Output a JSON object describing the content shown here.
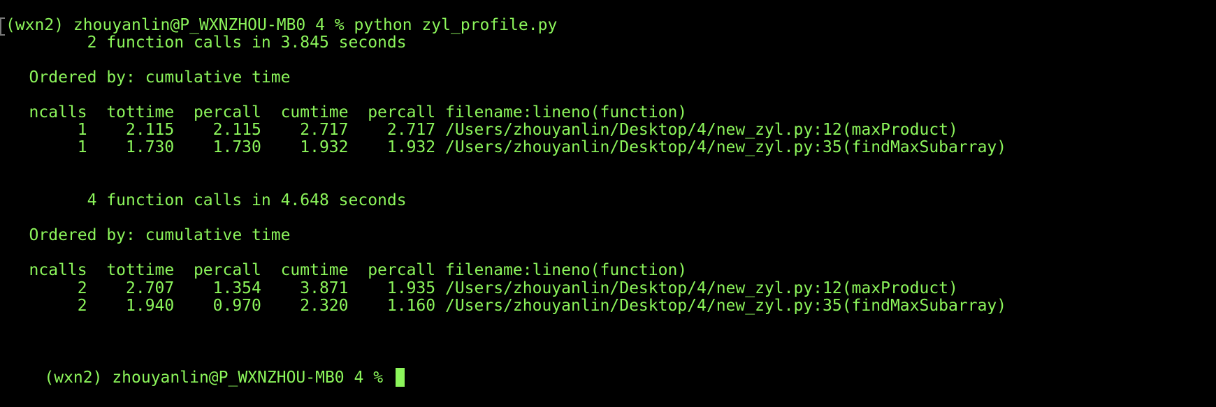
{
  "terminal": {
    "lines": [
      "(wxn2) zhouyanlin@P_WXNZHOU-MB0 4 % python zyl_profile.py",
      "         2 function calls in 3.845 seconds",
      "",
      "   Ordered by: cumulative time",
      "",
      "   ncalls  tottime  percall  cumtime  percall filename:lineno(function)",
      "        1    2.115    2.115    2.717    2.717 /Users/zhouyanlin/Desktop/4/new_zyl.py:12(maxProduct)",
      "        1    1.730    1.730    1.932    1.932 /Users/zhouyanlin/Desktop/4/new_zyl.py:35(findMaxSubarray)",
      "",
      "",
      "         4 function calls in 4.648 seconds",
      "",
      "   Ordered by: cumulative time",
      "",
      "   ncalls  tottime  percall  cumtime  percall filename:lineno(function)",
      "        2    2.707    1.354    3.871    1.935 /Users/zhouyanlin/Desktop/4/new_zyl.py:12(maxProduct)",
      "        2    1.940    0.970    2.320    1.160 /Users/zhouyanlin/Desktop/4/new_zyl.py:35(findMaxSubarray)",
      "",
      "",
      "(wxn2) zhouyanlin@P_WXNZHOU-MB0 4 % "
    ],
    "colors": {
      "background": "#000000",
      "text": "#8cf55b",
      "cursor": "#8cf55b"
    }
  }
}
